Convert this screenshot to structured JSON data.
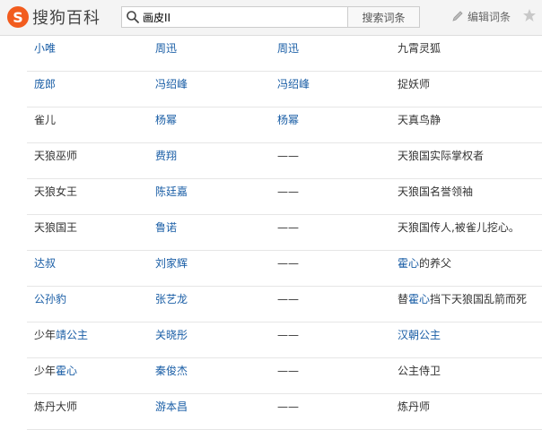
{
  "header": {
    "logo_symbol": "S",
    "logo_text": "搜狗百科",
    "search_value": "画皮II",
    "search_button": "搜索词条",
    "edit_label": "编辑词条",
    "icons": [
      "search-icon",
      "pencil-icon",
      "star-icon"
    ]
  },
  "colors": {
    "link": "#1a5ea6",
    "text": "#333333",
    "brand": "#f25c1e"
  },
  "rows": [
    {
      "cells": [
        {
          "segs": [
            {
              "t": "小唯",
              "link": true
            }
          ]
        },
        {
          "segs": [
            {
              "t": "周迅",
              "link": true
            }
          ]
        },
        {
          "segs": [
            {
              "t": "周迅",
              "link": true
            }
          ]
        },
        {
          "segs": [
            {
              "t": "九霄灵狐",
              "link": false
            }
          ]
        }
      ]
    },
    {
      "cells": [
        {
          "segs": [
            {
              "t": "庞郎",
              "link": true
            }
          ]
        },
        {
          "segs": [
            {
              "t": "冯绍峰",
              "link": true
            }
          ]
        },
        {
          "segs": [
            {
              "t": "冯绍峰",
              "link": true
            }
          ]
        },
        {
          "segs": [
            {
              "t": "捉妖师",
              "link": false
            }
          ]
        }
      ]
    },
    {
      "cells": [
        {
          "segs": [
            {
              "t": "雀儿",
              "link": false
            }
          ]
        },
        {
          "segs": [
            {
              "t": "杨幂",
              "link": true
            }
          ]
        },
        {
          "segs": [
            {
              "t": "杨幂",
              "link": true
            }
          ]
        },
        {
          "segs": [
            {
              "t": "天真鸟静",
              "link": false
            }
          ]
        }
      ]
    },
    {
      "cells": [
        {
          "segs": [
            {
              "t": "天狼巫师",
              "link": false
            }
          ]
        },
        {
          "segs": [
            {
              "t": "费翔",
              "link": true
            }
          ]
        },
        {
          "segs": [
            {
              "t": "——",
              "link": false
            }
          ]
        },
        {
          "segs": [
            {
              "t": "天狼国实际掌权者",
              "link": false
            }
          ]
        }
      ]
    },
    {
      "cells": [
        {
          "segs": [
            {
              "t": "天狼女王",
              "link": false
            }
          ]
        },
        {
          "segs": [
            {
              "t": "陈廷嘉",
              "link": true
            }
          ]
        },
        {
          "segs": [
            {
              "t": "——",
              "link": false
            }
          ]
        },
        {
          "segs": [
            {
              "t": "天狼国名誉领袖",
              "link": false
            }
          ]
        }
      ]
    },
    {
      "cells": [
        {
          "segs": [
            {
              "t": "天狼国王",
              "link": false
            }
          ]
        },
        {
          "segs": [
            {
              "t": "鲁诺",
              "link": true
            }
          ]
        },
        {
          "segs": [
            {
              "t": "——",
              "link": false
            }
          ]
        },
        {
          "segs": [
            {
              "t": "天狼国传人,被雀儿挖心。",
              "link": false
            }
          ]
        }
      ]
    },
    {
      "cells": [
        {
          "segs": [
            {
              "t": "达叔",
              "link": true
            }
          ]
        },
        {
          "segs": [
            {
              "t": "刘家辉",
              "link": true
            }
          ]
        },
        {
          "segs": [
            {
              "t": "——",
              "link": false
            }
          ]
        },
        {
          "segs": [
            {
              "t": "霍心",
              "link": true
            },
            {
              "t": "的养父",
              "link": false
            }
          ]
        }
      ]
    },
    {
      "cells": [
        {
          "segs": [
            {
              "t": "公孙豹",
              "link": true
            }
          ]
        },
        {
          "segs": [
            {
              "t": "张艺龙",
              "link": true
            }
          ]
        },
        {
          "segs": [
            {
              "t": "——",
              "link": false
            }
          ]
        },
        {
          "segs": [
            {
              "t": "替",
              "link": false
            },
            {
              "t": "霍心",
              "link": true
            },
            {
              "t": "挡下天狼国乱箭而死",
              "link": false
            }
          ]
        }
      ]
    },
    {
      "cells": [
        {
          "segs": [
            {
              "t": "少年",
              "link": false
            },
            {
              "t": "靖公主",
              "link": true
            }
          ]
        },
        {
          "segs": [
            {
              "t": "关晓彤",
              "link": true
            }
          ]
        },
        {
          "segs": [
            {
              "t": "——",
              "link": false
            }
          ]
        },
        {
          "segs": [
            {
              "t": "汉朝公主",
              "link": true
            }
          ]
        }
      ]
    },
    {
      "cells": [
        {
          "segs": [
            {
              "t": "少年",
              "link": false
            },
            {
              "t": "霍心",
              "link": true
            }
          ]
        },
        {
          "segs": [
            {
              "t": "秦俊杰",
              "link": true
            }
          ]
        },
        {
          "segs": [
            {
              "t": "——",
              "link": false
            }
          ]
        },
        {
          "segs": [
            {
              "t": "公主侍卫",
              "link": false
            }
          ]
        }
      ]
    },
    {
      "cells": [
        {
          "segs": [
            {
              "t": "炼丹大师",
              "link": false
            }
          ]
        },
        {
          "segs": [
            {
              "t": "游本昌",
              "link": true
            }
          ]
        },
        {
          "segs": [
            {
              "t": "——",
              "link": false
            }
          ]
        },
        {
          "segs": [
            {
              "t": "炼丹师",
              "link": false
            }
          ]
        }
      ]
    }
  ]
}
